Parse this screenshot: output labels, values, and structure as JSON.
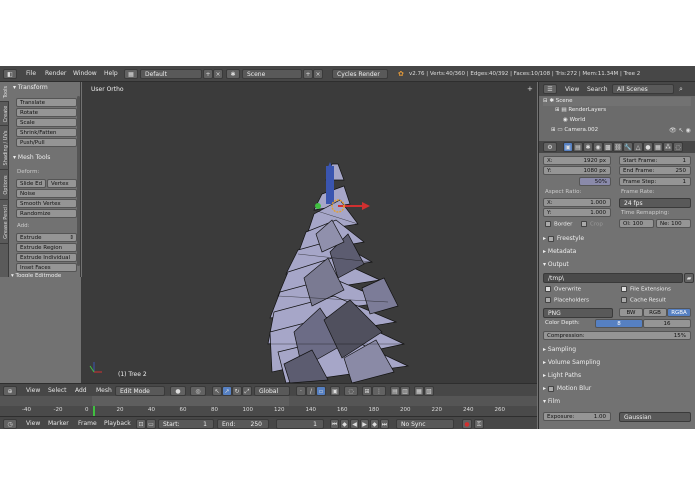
{
  "menubar": {
    "items": [
      "File",
      "Render",
      "Window",
      "Help"
    ],
    "layout": "Default",
    "scene": "Scene",
    "engine": "Cycles Render",
    "stats": "v2.76 | Verts:40/360 | Edges:40/392 | Faces:10/108 | Tris:272 | Mem:11.34M | Tree 2"
  },
  "tabs": [
    "Tools",
    "Create",
    "Shading / UVs",
    "Options",
    "Grease Pencil"
  ],
  "toolshelf": {
    "transform_header": "Transform",
    "transform": [
      "Translate",
      "Rotate",
      "Scale",
      "Shrink/Fatten",
      "Push/Pull"
    ],
    "mesh_header": "Mesh Tools",
    "deform_label": "Deform:",
    "slide_edge": "Slide Ed",
    "vertex": "Vertex",
    "deform": [
      "Noise",
      "Smooth Vertex",
      "Randomize"
    ],
    "add_label": "Add:",
    "extrude": "Extrude",
    "add": [
      "Extrude Region",
      "Extrude Individual",
      "Inset Faces"
    ],
    "toggle": "Toggle Editmode"
  },
  "viewport": {
    "label": "User Ortho",
    "object": "(1) Tree 2"
  },
  "viewheader": {
    "view": "View",
    "select": "Select",
    "add": "Add",
    "mesh": "Mesh",
    "mode": "Edit Mode",
    "orientation": "Global"
  },
  "timeline": {
    "ticks": [
      "-40",
      "-20",
      "0",
      "20",
      "40",
      "60",
      "80",
      "100",
      "120",
      "140",
      "160",
      "180",
      "200",
      "220",
      "240",
      "260"
    ],
    "current": "1"
  },
  "timebar": {
    "items": [
      "View",
      "Marker",
      "Frame",
      "Playback"
    ],
    "start_label": "Start:",
    "start": "1",
    "end_label": "End:",
    "end": "250",
    "current": "1",
    "sync": "No Sync"
  },
  "outliner": {
    "view": "View",
    "search": "Search",
    "scenes": "All Scenes",
    "items": [
      "Scene",
      "RenderLayers",
      "World",
      "Camera.002"
    ]
  },
  "props": {
    "res_x_label": "X:",
    "res_x": "1920 px",
    "res_y_label": "Y:",
    "res_y": "1080 px",
    "res_pct": "50%",
    "start_label": "Start Frame:",
    "start": "1",
    "end_label": "End Frame:",
    "end": "250",
    "step_label": "Frame Step:",
    "step": "1",
    "aspect_label": "Aspect Ratio:",
    "ax_label": "X:",
    "ax": "1.000",
    "ay_label": "Y:",
    "ay": "1.000",
    "rate_label": "Frame Rate:",
    "rate": "24 fps",
    "remap_label": "Time Remapping:",
    "old": "Ol: 100",
    "new": "Ne: 100",
    "border": "Border",
    "crop": "Crop",
    "freestyle": "Freestyle",
    "metadata": "Metadata",
    "output": "Output",
    "path": "/tmp\\",
    "overwrite": "Overwrite",
    "file_ext": "File Extensions",
    "placeholders": "Placeholders",
    "cache": "Cache Result",
    "format": "PNG",
    "bw": "BW",
    "rgb": "RGB",
    "rgba": "RGBA",
    "depth_label": "Color Depth:",
    "depth8": "8",
    "depth16": "16",
    "compression": "Compression:",
    "compression_val": "15%",
    "sampling": "Sampling",
    "volume": "Volume Sampling",
    "light": "Light Paths",
    "motion": "Motion Blur",
    "film": "Film",
    "exposure_label": "Exposure:",
    "exposure": "1.00",
    "filter": "Gaussian"
  },
  "colors": {
    "accent": "#5680c2",
    "viewport_bg": "#3b3b3b",
    "face": "#a6a6c8"
  }
}
